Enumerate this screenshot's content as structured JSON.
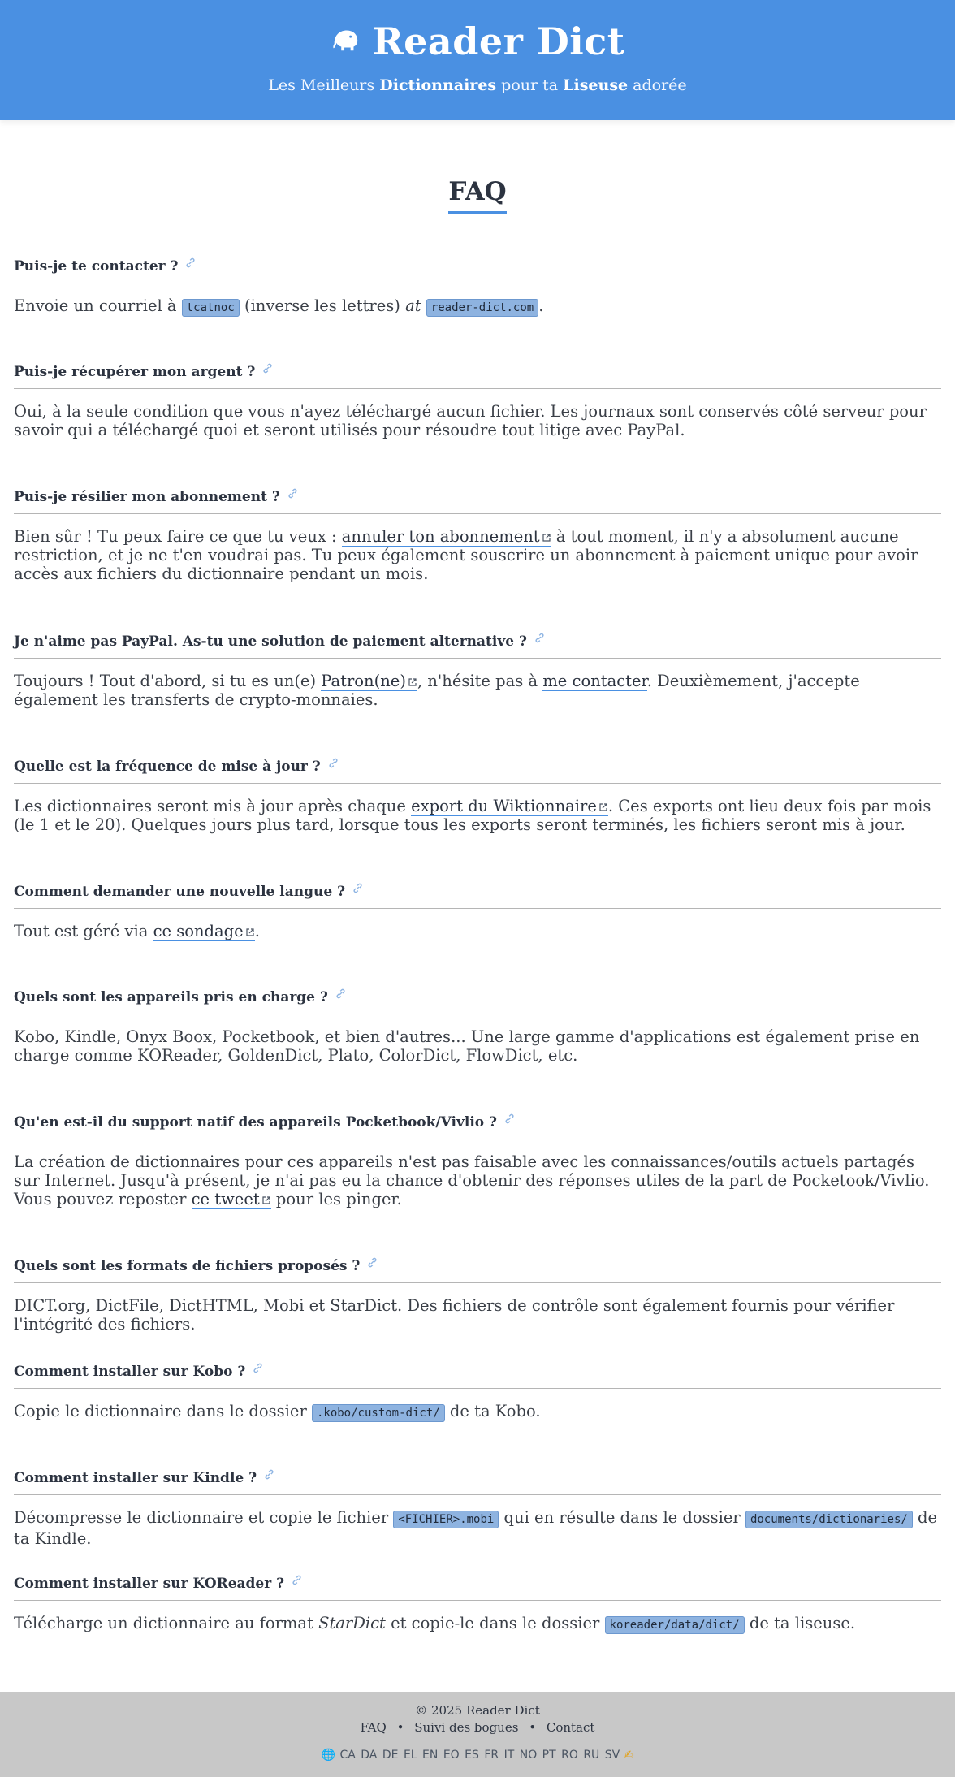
{
  "header": {
    "title": "Reader Dict",
    "tagline_pre": "Les Meilleurs ",
    "tagline_b1": "Dictionnaires",
    "tagline_mid": " pour ta ",
    "tagline_b2": "Liseuse",
    "tagline_post": " adorée",
    "logo_icon": "elephant-icon"
  },
  "page_title": "FAQ",
  "faq": [
    {
      "q": "Puis-je te contacter ?",
      "a": {
        "t1": "Envoie un courriel à ",
        "code1": "tcatnoc",
        "t2": " (inverse les lettres) ",
        "em": "at",
        "t3": " ",
        "code2": "reader-dict.com",
        "t4": "."
      }
    },
    {
      "q": "Puis-je récupérer mon argent ?",
      "a": "Oui, à la seule condition que vous n'ayez téléchargé aucun fichier. Les journaux sont conservés côté serveur pour savoir qui a téléchargé quoi et seront utilisés pour résoudre tout litige avec PayPal."
    },
    {
      "q": "Puis-je résilier mon abonnement ?",
      "a": {
        "t1": "Bien sûr ! Tu peux faire ce que tu veux : ",
        "link": "annuler ton abonnement",
        "t2": " à tout moment, il n'y a absolument aucune restriction, et je ne t'en voudrai pas. Tu peux également souscrire un abonnement à paiement unique pour avoir accès aux fichiers du dictionnaire pendant un mois."
      }
    },
    {
      "q": "Je n'aime pas PayPal. As-tu une solution de paiement alternative ?",
      "a": {
        "t1": "Toujours ! Tout d'abord, si tu es un(e) ",
        "link1": "Patron(ne)",
        "t2": ", n'hésite pas à ",
        "link2": "me contacter",
        "t3": ". Deuxièmement, j'accepte également les transferts de crypto-monnaies."
      }
    },
    {
      "q": "Quelle est la fréquence de mise à jour ?",
      "a": {
        "t1": "Les dictionnaires seront mis à jour après chaque ",
        "link": "export du Wiktionnaire",
        "t2": ". Ces exports ont lieu deux fois par mois (le 1 et le 20). Quelques jours plus tard, lorsque tous les exports seront terminés, les fichiers seront mis à jour."
      }
    },
    {
      "q": "Comment demander une nouvelle langue ?",
      "a": {
        "t1": "Tout est géré via ",
        "link": "ce sondage",
        "t2": "."
      }
    },
    {
      "q": "Quels sont les appareils pris en charge ?",
      "a": "Kobo, Kindle, Onyx Boox, Pocketbook, et bien d'autres... Une large gamme d'applications est également prise en charge comme KOReader, GoldenDict, Plato, ColorDict, FlowDict, etc."
    },
    {
      "q": "Qu'en est-il du support natif des appareils Pocketbook/Vivlio ?",
      "a": {
        "t1": "La création de dictionnaires pour ces appareils n'est pas faisable avec les connaissances/outils actuels partagés sur Internet. Jusqu'à présent, je n'ai pas eu la chance d'obtenir des réponses utiles de la part de Pocketook/Vivlio. Vous pouvez reposter ",
        "link": "ce tweet",
        "t2": " pour les pinger."
      }
    },
    {
      "q": "Quels sont les formats de fichiers proposés ?",
      "a": "DICT.org, DictFile, DictHTML, Mobi et StarDict. Des fichiers de contrôle sont également fournis pour vérifier l'intégrité des fichiers."
    },
    {
      "q": "Comment installer sur Kobo ?",
      "a": {
        "t1": "Copie le dictionnaire dans le dossier ",
        "code1": ".kobo/custom-dict/",
        "t2": " de ta Kobo."
      }
    },
    {
      "q": "Comment installer sur Kindle ?",
      "a": {
        "t1": "Décompresse le dictionnaire et copie le fichier ",
        "code1": "<FICHIER>.mobi",
        "t2": " qui en résulte dans le dossier ",
        "code2": "documents/dictionaries/",
        "t3": " de ta Kindle."
      }
    },
    {
      "q": "Comment installer sur KOReader ?",
      "a": {
        "t1": "Télécharge un dictionnaire au format ",
        "em": "StarDict",
        "t2": " et copie-le dans le dossier ",
        "code1": "koreader/data/dict/",
        "t3": " de ta liseuse."
      }
    }
  ],
  "footer": {
    "copyright": "© 2025 Reader Dict",
    "links": [
      "FAQ",
      "Suivi des bogues",
      "Contact"
    ],
    "sep": "•",
    "globe": "🌐",
    "langs": [
      "CA",
      "DA",
      "DE",
      "EL",
      "EN",
      "EO",
      "ES",
      "FR",
      "IT",
      "NO",
      "PT",
      "RO",
      "RU",
      "SV"
    ],
    "hand": "✍"
  }
}
